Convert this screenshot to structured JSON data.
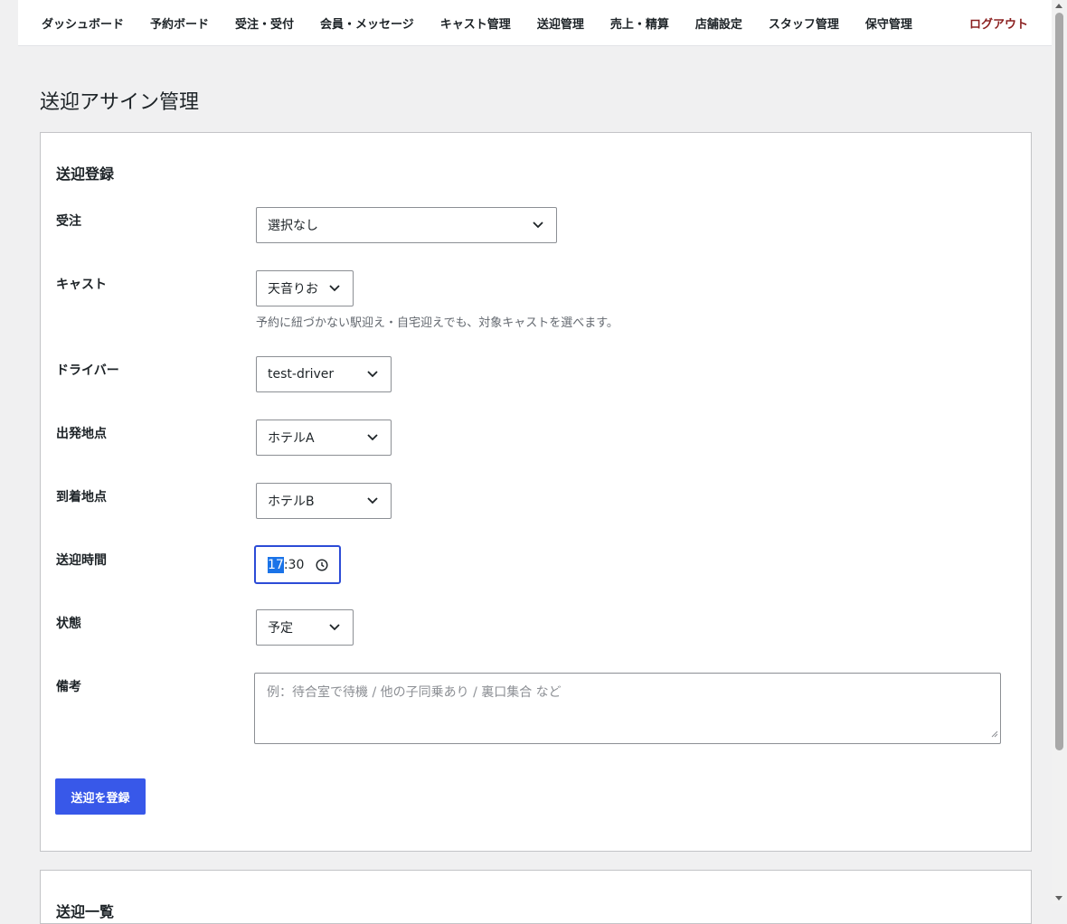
{
  "nav": {
    "items": [
      "ダッシュボード",
      "予約ボード",
      "受注・受付",
      "会員・メッセージ",
      "キャスト管理",
      "送迎管理",
      "売上・精算",
      "店舗設定",
      "スタッフ管理",
      "保守管理"
    ],
    "logout": "ログアウト"
  },
  "page": {
    "title": "送迎アサイン管理"
  },
  "register": {
    "heading": "送迎登録",
    "order": {
      "label": "受注",
      "value": "選択なし"
    },
    "cast": {
      "label": "キャスト",
      "value": "天音りお",
      "help": "予約に紐づかない駅迎え・自宅迎えでも、対象キャストを選べます。"
    },
    "driver": {
      "label": "ドライバー",
      "value": "test-driver"
    },
    "departure": {
      "label": "出発地点",
      "value": "ホテルA"
    },
    "arrival": {
      "label": "到着地点",
      "value": "ホテルB"
    },
    "time": {
      "label": "送迎時間",
      "hours": "17",
      "separator": ":",
      "minutes": "30"
    },
    "status": {
      "label": "状態",
      "value": "予定"
    },
    "notes": {
      "label": "備考",
      "placeholder": "例：待合室で待機 / 他の子同乗あり / 裏口集合 など"
    },
    "submit": "送迎を登録"
  },
  "list": {
    "heading": "送迎一覧"
  },
  "icons": {
    "select_arrow": "chevron-down-icon",
    "time": "clock-icon"
  },
  "colors": {
    "primary": "#3858e9",
    "logout": "#8a1f1f",
    "focus": "#2c4bd6"
  }
}
